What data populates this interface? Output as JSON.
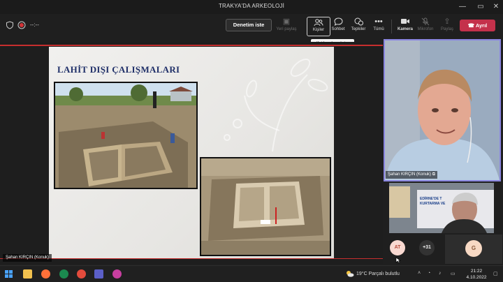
{
  "window": {
    "title": "TRAKYA'DA ARKEOLOJİ"
  },
  "toolbar": {
    "timer": "--:--",
    "denetim_label": "Denetim iste",
    "buttons": [
      {
        "label": "Yeri paylaş"
      },
      {
        "label": "Kişiler"
      },
      {
        "label": "Sohbet"
      },
      {
        "label": "Tepkiler"
      },
      {
        "label": "Tümü"
      },
      {
        "label": "Kamera"
      },
      {
        "label": "Mikrofon"
      },
      {
        "label": "Paylaş"
      }
    ],
    "leave_label": "Ayrıl",
    "tooltip": "Katılımcıları göster"
  },
  "slide": {
    "title": "LAHİT DIŞI ÇALIŞMALARI",
    "presenter": "Şahan KIRÇIN (Konuk)"
  },
  "participants": {
    "main_name": "Şahan KIRÇIN (Konuk)",
    "second_banner": "EDİRNE'DE T KURTARMA VE",
    "avatar_at": "AT",
    "overflow": "+31",
    "avatar_g": "G"
  },
  "taskbar": {
    "weather": "19°C  Parçalı bulutlu",
    "time": "21:22",
    "date": "4.10.2022"
  },
  "colors": {
    "leave": "#c4314b",
    "active_border": "#8b86e0",
    "slide_title": "#1f2f68"
  }
}
